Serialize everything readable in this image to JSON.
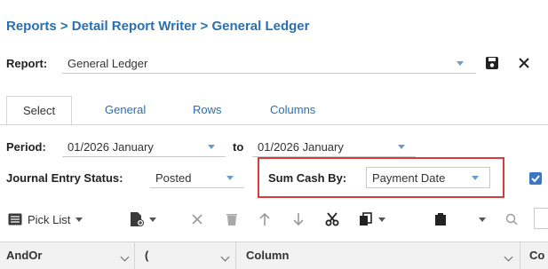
{
  "breadcrumb": "Reports > Detail Report Writer > General Ledger",
  "report": {
    "label": "Report:",
    "value": "General Ledger"
  },
  "tabs": [
    {
      "label": "Select"
    },
    {
      "label": "General"
    },
    {
      "label": "Rows"
    },
    {
      "label": "Columns"
    }
  ],
  "period": {
    "label": "Period:",
    "from": "01/2026  January",
    "to_label": "to",
    "to": "01/2026  January"
  },
  "journal_status": {
    "label": "Journal Entry Status:",
    "value": "Posted"
  },
  "sum_cash": {
    "label": "Sum Cash By:",
    "value": "Payment Date"
  },
  "toolbar": {
    "pick_list": "Pick List"
  },
  "grid": {
    "columns": [
      "AndOr",
      "(",
      "Column",
      "Co"
    ]
  },
  "colors": {
    "accent": "#2a6fb0",
    "highlight": "#d93a3a",
    "checkbox": "#3b78c2"
  }
}
